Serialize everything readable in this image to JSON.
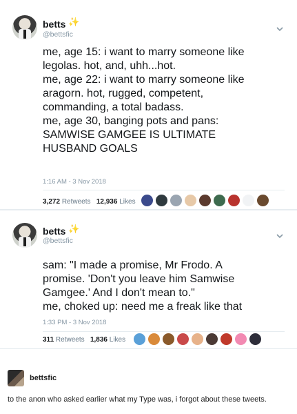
{
  "tweets": [
    {
      "display_name": "betts",
      "sparkle": "✨",
      "handle": "@bettsfic",
      "lines": [
        "me, age 15: i want to marry someone like",
        "legolas. hot, and, uhh...hot.",
        "me, age 22: i want to marry someone like",
        "aragorn. hot, rugged, competent,",
        "commanding, a total badass.",
        "me, age 30, banging pots and pans:",
        "SAMWISE GAMGEE IS ULTIMATE",
        "HUSBAND GOALS"
      ],
      "timestamp": "1:16 AM - 3 Nov 2018",
      "retweets": "3,272",
      "retweets_label": "Retweets",
      "likes": "12,936",
      "likes_label": "Likes",
      "liker_colors": [
        "#3b4a8c",
        "#2f3a3f",
        "#9aa5b1",
        "#e7c9a8",
        "#5b3a2e",
        "#3e6b4f",
        "#b8332e",
        "#f1f3f5",
        "#6a4a2f"
      ]
    },
    {
      "display_name": "betts",
      "sparkle": "✨",
      "handle": "@bettsfic",
      "lines": [
        "sam: \"I made a promise, Mr Frodo. A",
        "promise. 'Don't you leave him Samwise",
        "Gamgee.' And I don't mean to.\"",
        "me, choked up: need me a freak like that"
      ],
      "timestamp": "1:33 PM - 3 Nov 2018",
      "retweets": "311",
      "retweets_label": "Retweets",
      "likes": "1,836",
      "likes_label": "Likes",
      "liker_colors": [
        "#5aa0d8",
        "#d98a3a",
        "#8a5a2b",
        "#c94a4a",
        "#e7b28a",
        "#4b3a35",
        "#c0392b",
        "#f28ab2",
        "#2d2d3a"
      ]
    }
  ],
  "post": {
    "username": "bettsfic",
    "caption": "to the anon who asked earlier what my Type was, i forgot about these tweets."
  }
}
